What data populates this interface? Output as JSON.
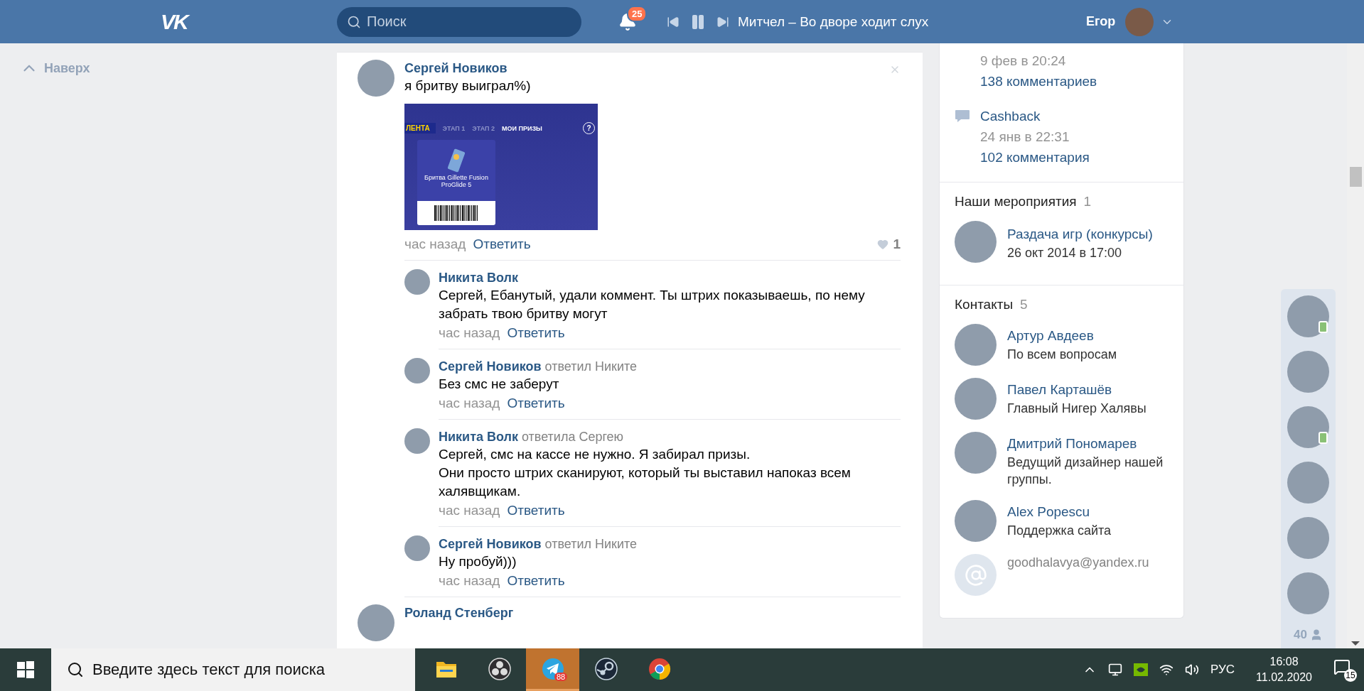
{
  "header": {
    "logo": "VK",
    "search_placeholder": "Поиск",
    "notifications": "25",
    "track": "Митчел – Во дворе ходит слух",
    "user": "Егор"
  },
  "back_link": "Наверх",
  "post": {
    "author": "Сергей Новиков",
    "text": "я бритву выиграл%)",
    "image": {
      "brand": "ЛЕНТА",
      "tabs": [
        {
          "label": "ЭТАП 1",
          "selected": false
        },
        {
          "label": "ЭТАП 2",
          "selected": false
        },
        {
          "label": "МОИ ПРИЗЫ",
          "selected": true
        }
      ],
      "help": "?",
      "prize": "Бритва Gillette Fusion ProGlide 5"
    },
    "time": "час назад",
    "reply": "Ответить",
    "likes": "1",
    "liked": false
  },
  "comments": [
    {
      "author": "Никита Волк",
      "text": [
        "Сергей, Ебанутый, удали коммент. Ты штрих показываешь, по нему забрать твою бритву могут"
      ],
      "time": "час назад",
      "reply": "Ответить"
    },
    {
      "author": "Сергей Новиков",
      "addressee": "ответил Никите",
      "text": [
        "Без смс не заберут"
      ],
      "time": "час назад",
      "reply": "Ответить"
    },
    {
      "author": "Никита Волк",
      "addressee": "ответила Сергею",
      "text": [
        "Сергей, смс на кассе не нужно. Я забирал призы.",
        "Они просто штрих сканируют, который ты выставил напоказ всем халявщикам."
      ],
      "time": "час назад",
      "reply": "Ответить"
    },
    {
      "author": "Сергей Новиков",
      "addressee": "ответил Никите",
      "text": [
        "Ну пробуй)))"
      ],
      "time": "час назад",
      "reply": "Ответить"
    }
  ],
  "next_post": {
    "author": "Роланд Стенберг"
  },
  "topics": [
    {
      "date": "9 фев в 20:24",
      "comments": "138 комментариев"
    },
    {
      "title": "Cashback",
      "date": "24 янв в 22:31",
      "comments": "102 комментария"
    }
  ],
  "events": {
    "heading": "Наши мероприятия",
    "count": "1",
    "items": [
      {
        "title": "Раздача игр (конкурсы)",
        "date": "26 окт 2014 в 17:00"
      }
    ]
  },
  "contacts": {
    "heading": "Контакты",
    "count": "5",
    "items": [
      {
        "kind": "person",
        "name": "Артур Авдеев",
        "role": "По всем вопросам"
      },
      {
        "kind": "person",
        "name": "Павел Карташёв",
        "role": "Главный Нигер Халявы"
      },
      {
        "kind": "person",
        "name": "Дмитрий Пономарев",
        "role": "Ведущий дизайнер нашей группы."
      },
      {
        "kind": "person",
        "name": "Alex Popescu",
        "role": "Поддержка сайта"
      },
      {
        "kind": "email",
        "name": "goodhalavya@yandex.ru"
      }
    ]
  },
  "friends": {
    "items": [
      {
        "online": true
      },
      {
        "online": false
      },
      {
        "online": true
      },
      {
        "online": false
      },
      {
        "online": false
      },
      {
        "online": false
      }
    ],
    "count": "40"
  },
  "taskbar": {
    "search_placeholder": "Введите здесь текст для поиска",
    "apps": [
      {
        "kind": "folder",
        "active": false
      },
      {
        "kind": "obs",
        "active": false
      },
      {
        "kind": "telegram",
        "active": true,
        "badge": "88"
      },
      {
        "kind": "steam",
        "active": false
      },
      {
        "kind": "chrome",
        "active": false
      }
    ],
    "language": "РУС",
    "time": "16:08",
    "date": "11.02.2020",
    "notifications": "15"
  }
}
